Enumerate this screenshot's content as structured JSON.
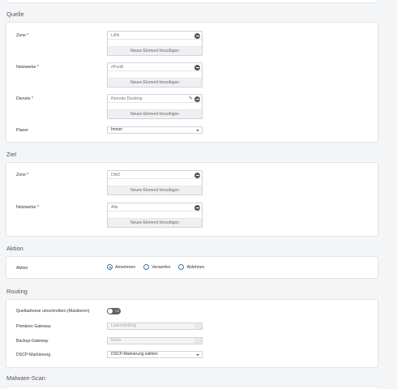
{
  "quelle": {
    "title": "Quelle",
    "zone": {
      "label": "Zone *",
      "chip": "LAN",
      "add": "Neues Element hinzufügen"
    },
    "netzwerke": {
      "label": "Netzwerke *",
      "chip": "#Port8",
      "add": "Neues Element hinzufügen"
    },
    "dienste": {
      "label": "Dienste *",
      "chip": "Remote Desktop",
      "add": "Neues Element hinzufügen"
    },
    "planer": {
      "label": "Planer",
      "value": "Immer"
    }
  },
  "ziel": {
    "title": "Ziel",
    "zone": {
      "label": "Zone *",
      "chip": "DMZ",
      "add": "Neues Element hinzufügen"
    },
    "netzwerke": {
      "label": "Netzwerke *",
      "chip": "Alle",
      "add": "Neues Element hinzufügen"
    }
  },
  "aktion": {
    "title": "Aktion",
    "label": "Aktion",
    "options": [
      "Annehmen",
      "Verwerfen",
      "Ablehnen"
    ],
    "selected": "Annehmen"
  },
  "routing": {
    "title": "Routing",
    "rewrite_label": "Quelladresse umschreiben (Maskieren)",
    "rewrite_toggle": "Off",
    "primary_label": "Primäres Gateway",
    "primary_value": "Lastverteilung",
    "backup_label": "Backup-Gateway",
    "backup_value": "Keine",
    "dscp_label": "DSCP-Markierung",
    "dscp_value": "DSCP-Markierung wählen"
  },
  "malware": {
    "title": "Malware-Scan"
  }
}
